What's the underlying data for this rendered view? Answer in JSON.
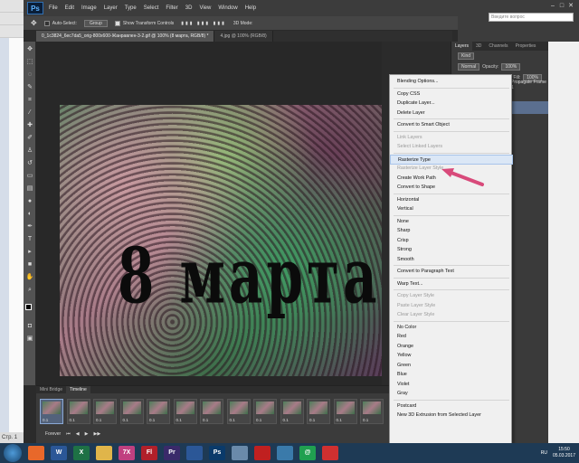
{
  "app": {
    "logo": "Ps"
  },
  "menu": [
    "File",
    "Edit",
    "Image",
    "Layer",
    "Type",
    "Select",
    "Filter",
    "3D",
    "View",
    "Window",
    "Help"
  ],
  "options": {
    "auto_select": "Auto-Select:",
    "group": "Group",
    "show_transform": "Show Transform Controls",
    "mode_3d": "3D Mode:"
  },
  "help_box": {
    "placeholder": "Введите вопрос"
  },
  "tabs": [
    {
      "label": "0_1c3824_6ec7da5_orig-800x600-Жанравлен-3-2.gif @ 100% (8 марта, RGB/8) *"
    },
    {
      "label": "4.jpg @ 100% (RGB/8)"
    }
  ],
  "artwork": {
    "title": "8 марта"
  },
  "panel": {
    "tabs": [
      "Layers",
      "3D",
      "Channels",
      "Properties"
    ],
    "kind": "Kind",
    "blend_mode": "Normal",
    "opacity_label": "Opacity:",
    "opacity_value": "100%",
    "fill_label": "Fill:",
    "fill_value": "100%",
    "propagate": "Propagate Frame 1"
  },
  "context_menu": [
    {
      "label": "Blending Options...",
      "disabled": false
    },
    {
      "sep": true
    },
    {
      "label": "Copy CSS",
      "disabled": false
    },
    {
      "label": "Duplicate Layer...",
      "disabled": false
    },
    {
      "label": "Delete Layer",
      "disabled": false
    },
    {
      "sep": true
    },
    {
      "label": "Convert to Smart Object",
      "disabled": false
    },
    {
      "sep": true
    },
    {
      "label": "Link Layers",
      "disabled": true
    },
    {
      "label": "Select Linked Layers",
      "disabled": true
    },
    {
      "sep": true
    },
    {
      "label": "Rasterize Type",
      "disabled": false,
      "highlight": true
    },
    {
      "label": "Rasterize Layer Style",
      "disabled": true
    },
    {
      "label": "Create Work Path",
      "disabled": false
    },
    {
      "label": "Convert to Shape",
      "disabled": false
    },
    {
      "sep": true
    },
    {
      "label": "Horizontal",
      "disabled": false
    },
    {
      "label": "Vertical",
      "disabled": false
    },
    {
      "sep": true
    },
    {
      "label": "None",
      "disabled": false
    },
    {
      "label": "Sharp",
      "disabled": false
    },
    {
      "label": "Crisp",
      "disabled": false
    },
    {
      "label": "Strong",
      "disabled": false
    },
    {
      "label": "Smooth",
      "disabled": false
    },
    {
      "sep": true
    },
    {
      "label": "Convert to Paragraph Text",
      "disabled": false
    },
    {
      "sep": true
    },
    {
      "label": "Warp Text...",
      "disabled": false
    },
    {
      "sep": true
    },
    {
      "label": "Copy Layer Style",
      "disabled": true
    },
    {
      "label": "Paste Layer Style",
      "disabled": true
    },
    {
      "label": "Clear Layer Style",
      "disabled": true
    },
    {
      "sep": true
    },
    {
      "label": "No Color",
      "disabled": false
    },
    {
      "label": "Red",
      "disabled": false
    },
    {
      "label": "Orange",
      "disabled": false
    },
    {
      "label": "Yellow",
      "disabled": false
    },
    {
      "label": "Green",
      "disabled": false
    },
    {
      "label": "Blue",
      "disabled": false
    },
    {
      "label": "Violet",
      "disabled": false
    },
    {
      "label": "Gray",
      "disabled": false
    },
    {
      "sep": true
    },
    {
      "label": "Postcard",
      "disabled": false
    },
    {
      "label": "New 3D Extrusion from Selected Layer",
      "disabled": false
    }
  ],
  "timeline": {
    "tabs": [
      "Mini Bridge",
      "Timeline"
    ],
    "frames": [
      {
        "num": "1",
        "delay": "0.1"
      },
      {
        "num": "2",
        "delay": "0.1"
      },
      {
        "num": "3",
        "delay": "0.1"
      },
      {
        "num": "4",
        "delay": "0.1"
      },
      {
        "num": "5",
        "delay": "0.1"
      },
      {
        "num": "6",
        "delay": "0.1"
      },
      {
        "num": "7",
        "delay": "0.1"
      },
      {
        "num": "8",
        "delay": "0.1"
      },
      {
        "num": "9",
        "delay": "0.1"
      },
      {
        "num": "10",
        "delay": "0.1"
      },
      {
        "num": "11",
        "delay": "0.1"
      },
      {
        "num": "12",
        "delay": "0.1"
      },
      {
        "num": "13",
        "delay": "0.1"
      }
    ],
    "loop": "Forever"
  },
  "word_status": "Стр. 1",
  "taskbar": {
    "lang": "RU",
    "time": "15:50",
    "date": "05.03.2017",
    "apps": [
      {
        "label": "",
        "color": "#e8682a"
      },
      {
        "label": "W",
        "color": "#2b5797"
      },
      {
        "label": "X",
        "color": "#1e7145"
      },
      {
        "label": "",
        "color": "#e0b54a"
      },
      {
        "label": "7X",
        "color": "#c04080"
      },
      {
        "label": "Fl",
        "color": "#b0202a"
      },
      {
        "label": "Pr",
        "color": "#3a2a6a"
      },
      {
        "label": "",
        "color": "#2b5797"
      },
      {
        "label": "Ps",
        "color": "#0a3a6a"
      },
      {
        "label": "",
        "color": "#6a8aaa"
      },
      {
        "label": "",
        "color": "#c02020"
      },
      {
        "label": "",
        "color": "#3a7aaa"
      },
      {
        "label": "@",
        "color": "#20a050"
      },
      {
        "label": "",
        "color": "#d03030"
      }
    ]
  },
  "colors": {
    "accent": "#5b6f8f",
    "arrow": "#d84a7a"
  }
}
